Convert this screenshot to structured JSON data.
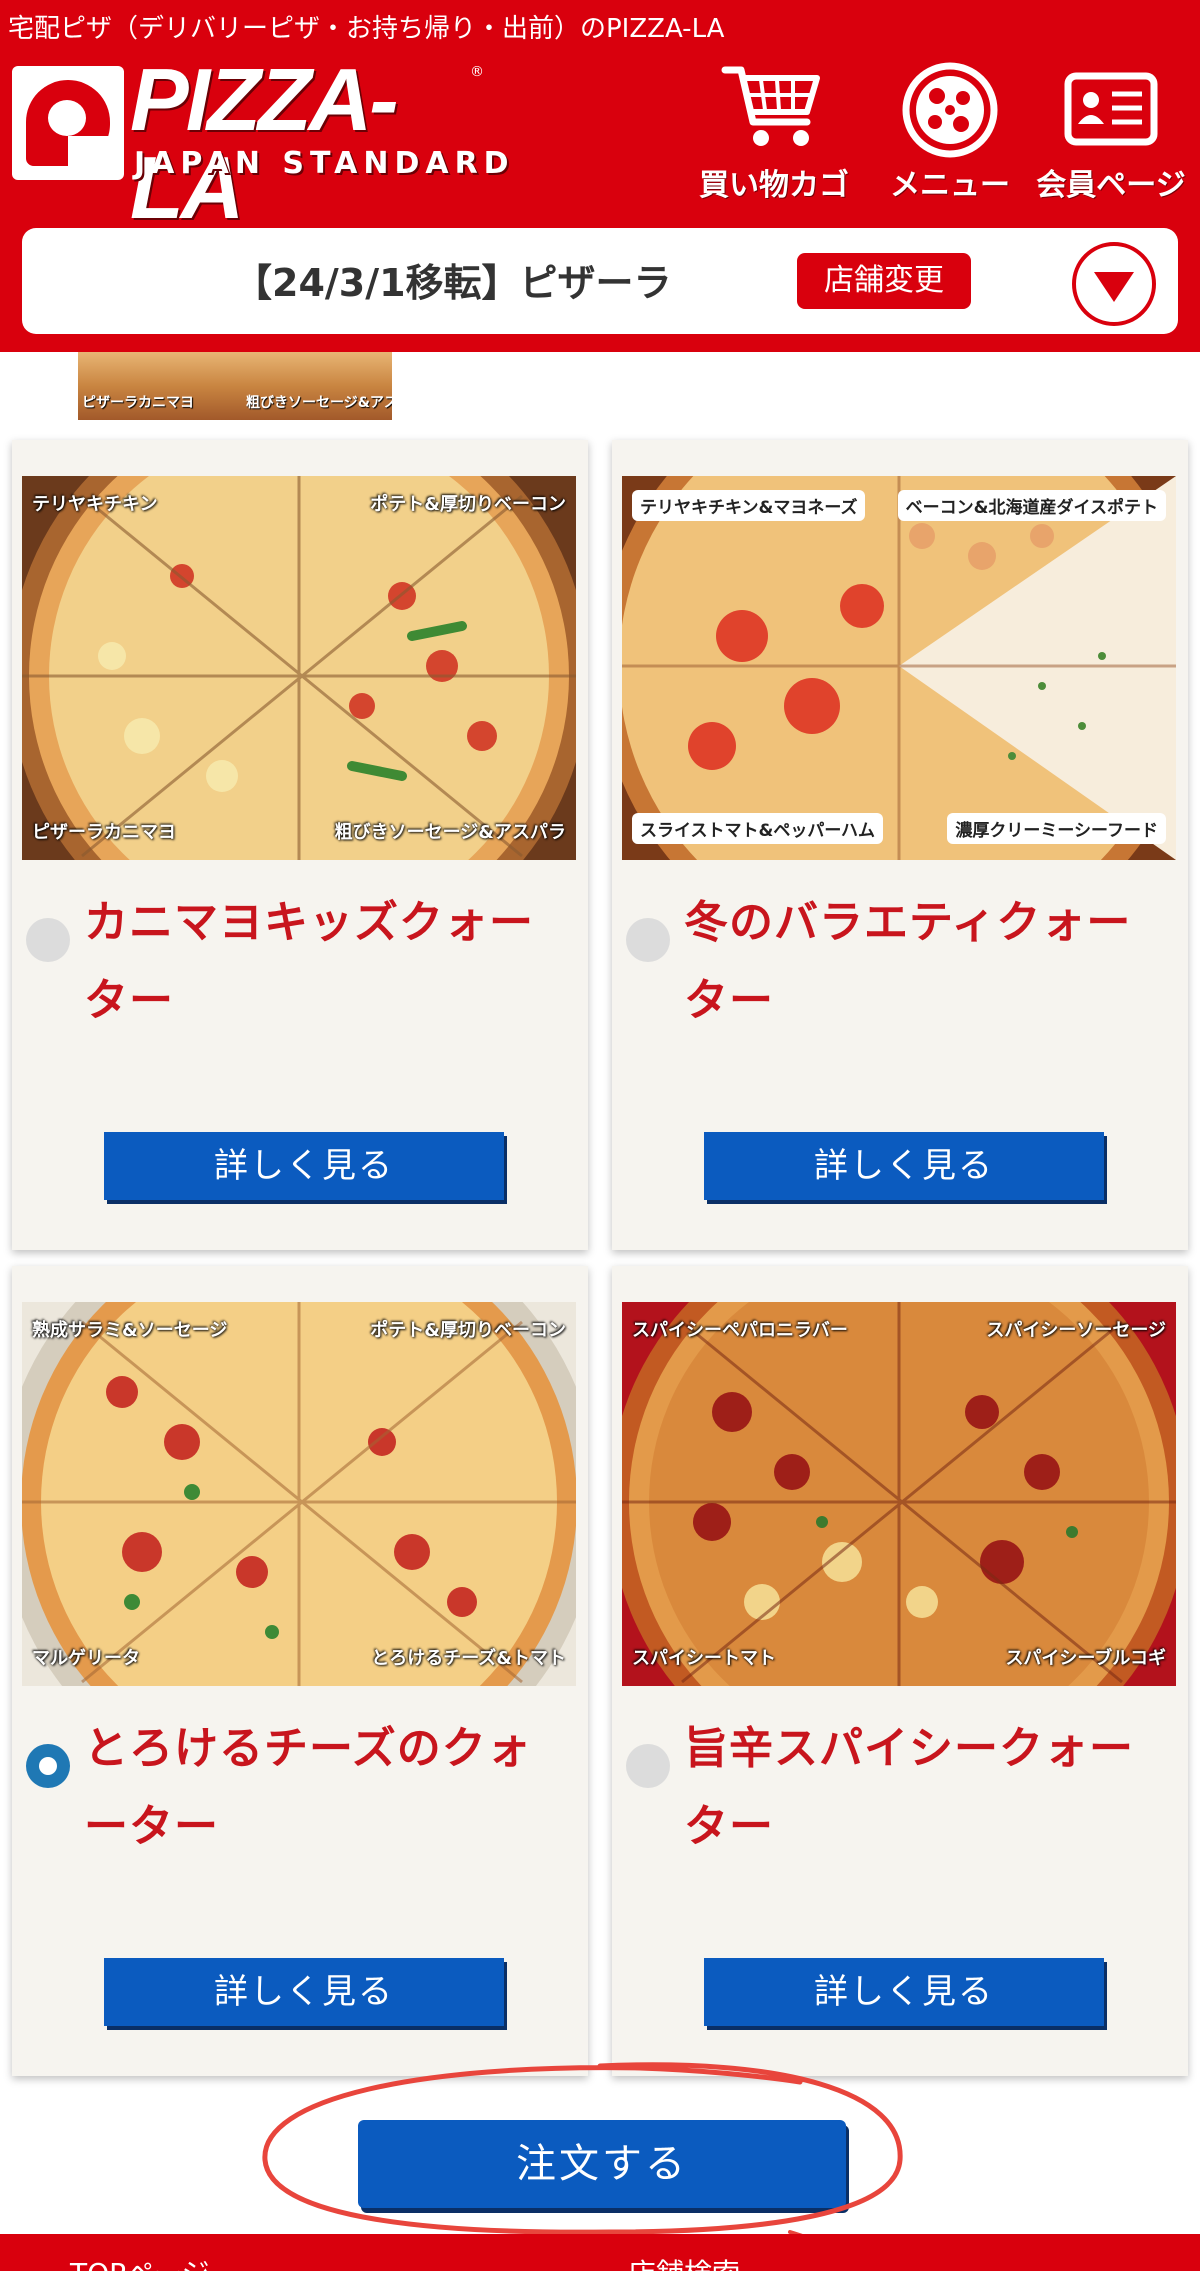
{
  "header": {
    "tagline": "宅配ピザ（デリバリーピザ・お持ち帰り・出前）のPIZZA-LA",
    "logo": {
      "word": "PIZZA-LA",
      "sub": "JAPAN STANDARD",
      "reg": "®"
    },
    "nav": [
      {
        "label": "買い物カゴ",
        "icon": "cart-icon"
      },
      {
        "label": "メニュー",
        "icon": "pizza-icon"
      },
      {
        "label": "会員ページ",
        "icon": "member-card-icon"
      }
    ],
    "store": {
      "name": "【24/3/1移転】ピザーラ",
      "change_label": "店舗変更",
      "toggle_icon": "chevron-down-icon"
    }
  },
  "partial_thumb": {
    "labels": [
      "ピザーラカニマヨ",
      "粗びきソーセージ&アスパラ"
    ]
  },
  "cards": [
    {
      "title": "カニマヨキッズクォーター",
      "selected": false,
      "image_labels": {
        "tl": "テリヤキチキン",
        "tr": "ポテト&厚切りベーコン",
        "bl": "ピザーラカニマヨ",
        "br": "粗びきソーセージ&アスパラ"
      },
      "detail_label": "詳しく見る"
    },
    {
      "title": "冬のバラエティクォーター",
      "selected": false,
      "image_labels": {
        "tl": "テリヤキチキン&マヨネーズ",
        "tr": "ベーコン&北海道産ダイスポテト",
        "bl": "スライストマト&ペッパーハム",
        "br": "濃厚クリーミーシーフード"
      },
      "detail_label": "詳しく見る"
    },
    {
      "title": "とろけるチーズのクォーター",
      "selected": true,
      "image_labels": {
        "tl": "熟成サラミ&ソーセージ",
        "tr": "ポテト&厚切りベーコン",
        "bl": "マルゲリータ",
        "br": "とろけるチーズ&トマト"
      },
      "detail_label": "詳しく見る"
    },
    {
      "title": "旨辛スパイシークォーター",
      "selected": false,
      "image_labels": {
        "tl": "スパイシーペパロニラバー",
        "tr": "スパイシーソーセージ",
        "bl": "スパイシートマト",
        "br": "スパイシーブルコギ"
      },
      "detail_label": "詳しく見る"
    }
  ],
  "order": {
    "label": "注文する"
  },
  "footer": {
    "links": [
      "TOPページ",
      "店舗検索"
    ]
  },
  "colors": {
    "brand_red": "#d9000d",
    "title_red": "#c8151d",
    "button_blue": "#0b5bbf",
    "radio_selected": "#1f78b4",
    "annotation_circle": "#e8453c"
  }
}
